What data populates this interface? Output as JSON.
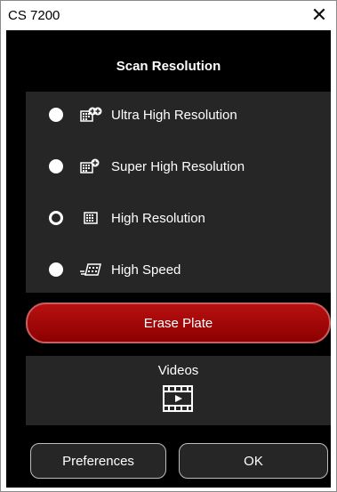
{
  "window": {
    "title": "CS 7200",
    "close_glyph": "✕"
  },
  "scan": {
    "heading": "Scan Resolution",
    "options": [
      {
        "label": "Ultra High Resolution",
        "selected": false,
        "icon": "ultra-high-resolution-icon"
      },
      {
        "label": "Super High Resolution",
        "selected": false,
        "icon": "super-high-resolution-icon"
      },
      {
        "label": "High Resolution",
        "selected": true,
        "icon": "high-resolution-icon"
      },
      {
        "label": "High Speed",
        "selected": false,
        "icon": "high-speed-icon"
      }
    ]
  },
  "actions": {
    "erase_label": "Erase Plate",
    "videos_label": "Videos",
    "preferences_label": "Preferences",
    "ok_label": "OK"
  },
  "colors": {
    "background": "#000000",
    "panel": "#262626",
    "erase_red": "#b81010",
    "text": "#ffffff"
  }
}
